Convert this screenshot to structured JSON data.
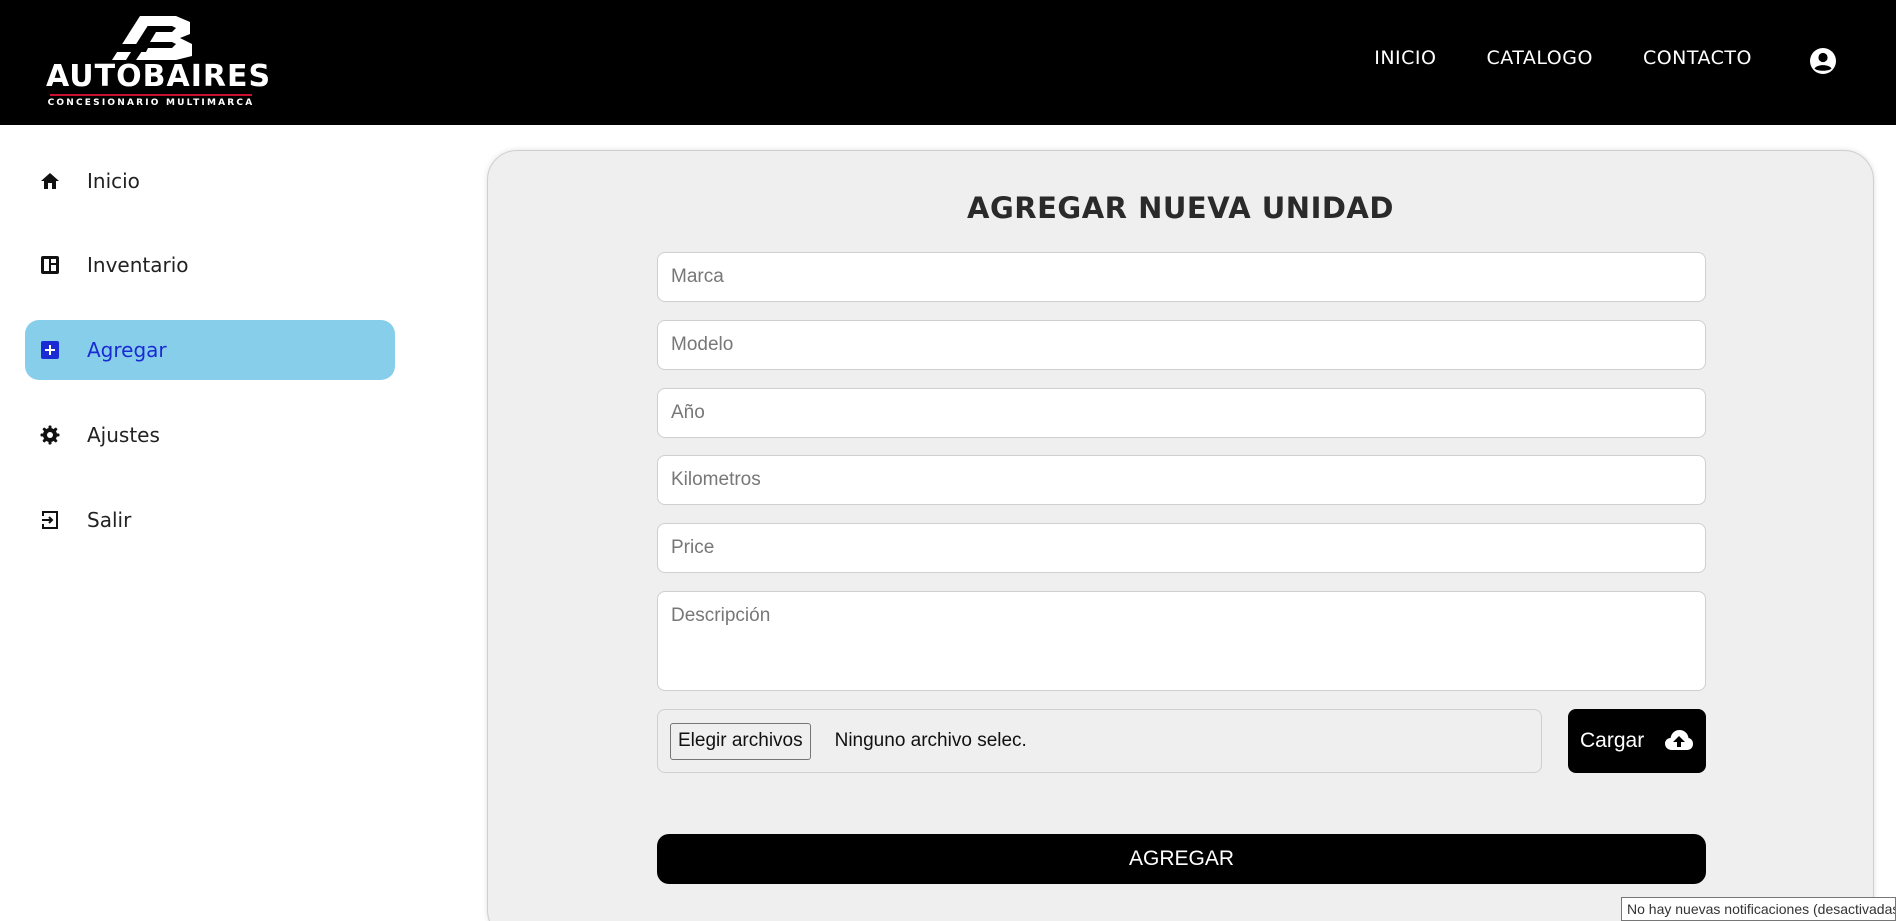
{
  "brand": {
    "name": "AUTOBAIRES",
    "tagline": "CONCESIONARIO MULTIMARCA",
    "accent_color": "#c8102e"
  },
  "topnav": {
    "items": [
      {
        "label": "INICIO"
      },
      {
        "label": "CATALOGO"
      },
      {
        "label": "CONTACTO"
      }
    ],
    "user_icon": "user-circle-icon"
  },
  "sidebar": {
    "items": [
      {
        "label": "Inicio",
        "icon": "home-icon"
      },
      {
        "label": "Inventario",
        "icon": "dashboard-icon"
      },
      {
        "label": "Agregar",
        "icon": "add-box-icon",
        "active": true
      },
      {
        "label": "Ajustes",
        "icon": "gear-icon"
      },
      {
        "label": "Salir",
        "icon": "logout-icon"
      }
    ],
    "active_bg": "#87ceeb",
    "active_color": "#1a2bd4"
  },
  "form": {
    "title": "AGREGAR NUEVA UNIDAD",
    "fields": {
      "marca": {
        "placeholder": "Marca",
        "value": ""
      },
      "modelo": {
        "placeholder": "Modelo",
        "value": ""
      },
      "anio": {
        "placeholder": "Año",
        "value": ""
      },
      "kilometros": {
        "placeholder": "Kilometros",
        "value": ""
      },
      "price": {
        "placeholder": "Price",
        "value": ""
      },
      "descripcion": {
        "placeholder": "Descripción",
        "value": ""
      }
    },
    "file": {
      "button_label": "Elegir archivos",
      "status": "Ninguno archivo selec."
    },
    "upload": {
      "label": "Cargar",
      "icon": "cloud-upload-icon"
    },
    "submit_label": "AGREGAR"
  },
  "tooltip": {
    "text": "No hay nuevas notificaciones (desactivadas)"
  }
}
